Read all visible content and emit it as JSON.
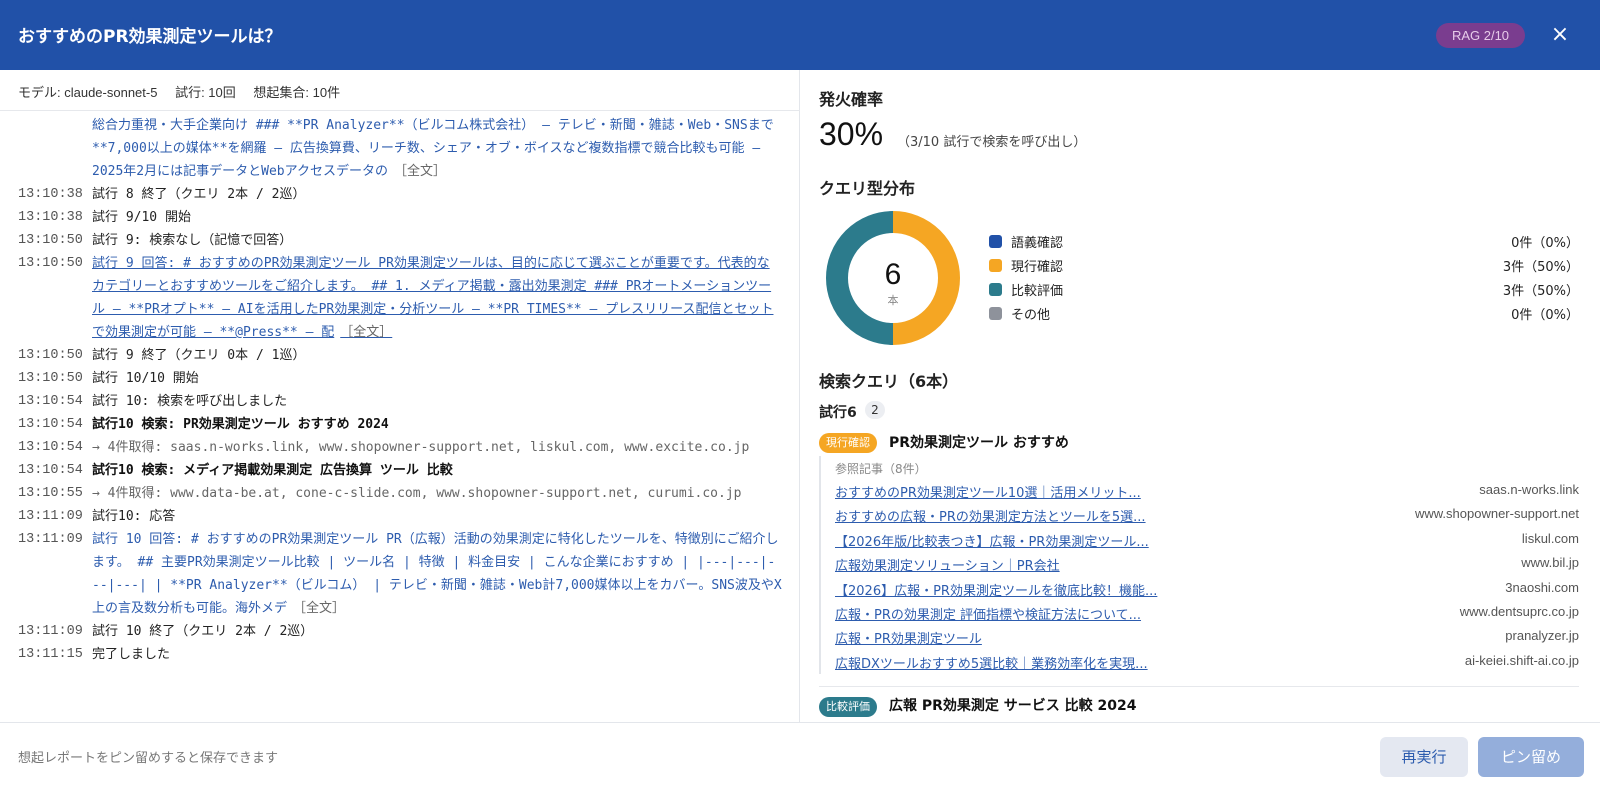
{
  "header": {
    "title": "おすすめのPR効果測定ツールは？",
    "rag_badge": "RAG 2/10",
    "close_label": "×"
  },
  "meta": {
    "model": "モデル: claude-sonnet-5",
    "trials": "試行: 10回",
    "set": "想起集合: 10件"
  },
  "log": [
    {
      "time": "",
      "text": "総合力重視・大手企業向け ### **PR Analyzer**（ビルコム株式会社） – テレビ・新聞・雑誌・Web・SNSまで**7,000以上の媒体**を網羅 – 広告換算費、リーチ数、シェア・オブ・ボイスなど複数指標で競合比較も可能 – 2025年2月には記事データとWebアクセスデータの",
      "style": "blue",
      "suffix": "［全文］"
    },
    {
      "time": "13:10:38",
      "text": "試行 8 終了（クエリ 2本 / 2巡）",
      "style": "plain",
      "suffix": ""
    },
    {
      "time": "13:10:38",
      "text": "試行 9/10 開始",
      "style": "plain",
      "suffix": ""
    },
    {
      "time": "13:10:50",
      "text": "試行 9: 検索なし（記憶で回答）",
      "style": "plain",
      "suffix": ""
    },
    {
      "time": "13:10:50",
      "text": "試行 9 回答: # おすすめのPR効果測定ツール PR効果測定ツールは、目的に応じて選ぶことが重要です。代表的なカテゴリーとおすすめツールをご紹介します。 ## 1. メディア掲載・露出効果測定 ### PRオートメーションツール – **PRオプト** – AIを活用したPR効果測定・分析ツール – **PR TIMES** – プレスリリース配信とセットで効果測定が可能 – **@Press** – 配",
      "style": "link",
      "suffix": "［全文］"
    },
    {
      "time": "13:10:50",
      "text": "試行 9 終了（クエリ 0本 / 1巡）",
      "style": "plain",
      "suffix": ""
    },
    {
      "time": "13:10:50",
      "text": "試行 10/10 開始",
      "style": "plain",
      "suffix": ""
    },
    {
      "time": "13:10:54",
      "text": "試行 10: 検索を呼び出しました",
      "style": "plain",
      "suffix": ""
    },
    {
      "time": "13:10:54",
      "text": "試行10 検索: PR効果測定ツール おすすめ 2024",
      "style": "bold",
      "suffix": ""
    },
    {
      "time": "13:10:54",
      "text": " → 4件取得: saas.n-works.link, www.shopowner-support.net, liskul.com, www.excite.co.jp",
      "style": "gray",
      "suffix": ""
    },
    {
      "time": "13:10:54",
      "text": "試行10 検索: メディア掲載効果測定 広告換算 ツール 比較",
      "style": "bold",
      "suffix": ""
    },
    {
      "time": "13:10:55",
      "text": " → 4件取得: www.data-be.at, cone-c-slide.com, www.shopowner-support.net, curumi.co.jp",
      "style": "gray",
      "suffix": ""
    },
    {
      "time": "13:11:09",
      "text": "試行10: 応答",
      "style": "plain",
      "suffix": ""
    },
    {
      "time": "13:11:09",
      "text": "試行 10 回答: # おすすめのPR効果測定ツール PR（広報）活動の効果測定に特化したツールを、特徴別にご紹介します。 ## 主要PR効果測定ツール比較 | ツール名 | 特徴 | 料金目安 | こんな企業におすすめ | |---|---|---|---| | **PR Analyzer**（ビルコム） | テレビ・新聞・雑誌・Web計7,000媒体以上をカバー。SNS波及やX上の言及数分析も可能。海外メデ",
      "style": "blue",
      "suffix": "［全文］"
    },
    {
      "time": "13:11:09",
      "text": "試行 10 終了（クエリ 2本 / 2巡）",
      "style": "plain",
      "suffix": ""
    },
    {
      "time": "13:11:15",
      "text": "完了しました",
      "style": "plain",
      "suffix": ""
    }
  ],
  "summary": {
    "fire_title": "発火確率",
    "fire_pct": "30%",
    "fire_note": "（3/10 試行で検索を呼び出し）",
    "dist_title": "クエリ型分布",
    "donut_total": "6",
    "donut_unit": "本",
    "queries_title": "検索クエリ（6本）"
  },
  "chart_data": {
    "type": "pie",
    "categories": [
      "語義確認",
      "現行確認",
      "比較評価",
      "その他"
    ],
    "values": [
      0,
      3,
      3,
      0
    ],
    "labels": [
      "0件（0%）",
      "3件（50%）",
      "3件（50%）",
      "0件（0%）"
    ],
    "colors": [
      "#2151a8",
      "#f5a623",
      "#2c7b8c",
      "#8e929b"
    ]
  },
  "queries": {
    "trial_label": "試行6",
    "trial_count": "2",
    "first": {
      "type_label": "現行確認",
      "query": "PR効果測定ツール おすすめ",
      "ref_head": "参照記事（8件）",
      "refs": [
        {
          "title": "おすすめのPR効果測定ツール10選｜活用メリット...",
          "domain": "saas.n-works.link"
        },
        {
          "title": "おすすめの広報・PRの効果測定方法とツールを5選...",
          "domain": "www.shopowner-support.net"
        },
        {
          "title": "【2026年版/比較表つき】広報・PR効果測定ツール...",
          "domain": "liskul.com"
        },
        {
          "title": "広報効果測定ソリューション｜PR会社",
          "domain": "www.bil.jp"
        },
        {
          "title": "【2026】広報・PR効果測定ツールを徹底比較！機能...",
          "domain": "3naoshi.com"
        },
        {
          "title": "広報・PRの効果測定 評価指標や検証方法について...",
          "domain": "www.dentsuprc.co.jp"
        },
        {
          "title": "広報・PR効果測定ツール",
          "domain": "pranalyzer.jp"
        },
        {
          "title": "広報DXツールおすすめ5選比較｜業務効率化を実現...",
          "domain": "ai-keiei.shift-ai.co.jp"
        }
      ]
    },
    "second": {
      "type_label": "比較評価",
      "query": "広報 PR効果測定 サービス 比較 2024"
    }
  },
  "footer": {
    "hint": "想起レポートをピン留めすると保存できます",
    "rerun_label": "再実行",
    "pin_label": "ピン留め"
  }
}
